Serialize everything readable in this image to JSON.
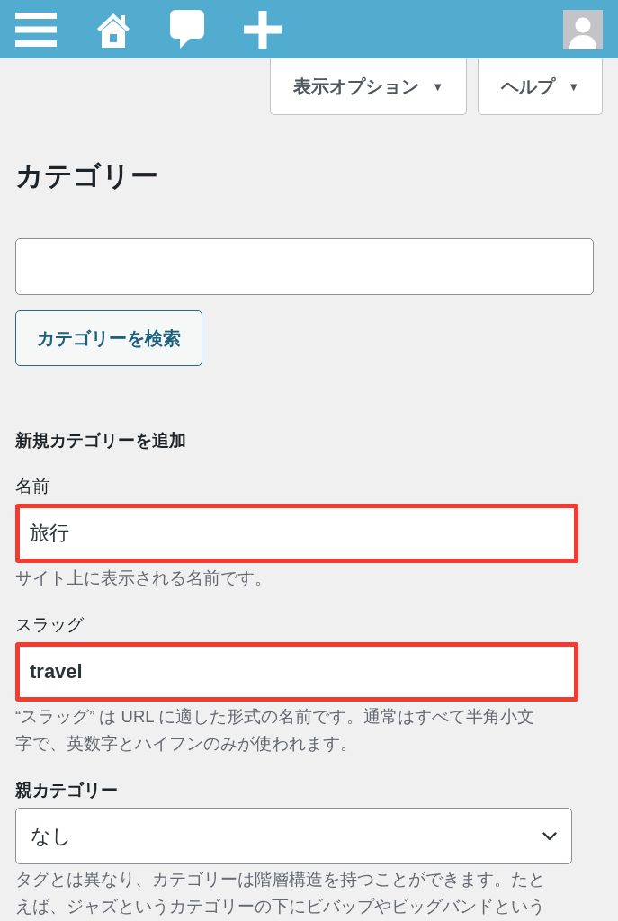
{
  "top_tabs": [
    {
      "label": "表示オプション",
      "caret": "▼"
    },
    {
      "label": "ヘルプ",
      "caret": "▼"
    }
  ],
  "page_title": "カテゴリー",
  "search": {
    "button": "カテゴリーを検索"
  },
  "add_form": {
    "heading": "新規カテゴリーを追加",
    "fields": [
      {
        "kind": "text",
        "label": "名前",
        "value": "旅行",
        "highlighted": true,
        "help": "サイト上に表示される名前です。"
      },
      {
        "kind": "text",
        "label": "スラッグ",
        "value": "travel",
        "highlighted": true,
        "help": "“スラッグ” は URL に適した形式の名前です。通常はすべて半角小文字で、英数字とハイフンのみが使われます。"
      },
      {
        "kind": "select",
        "label": "親カテゴリー",
        "value": "なし",
        "highlighted": false,
        "help": "タグとは異なり、カテゴリーは階層構造を持つことができます。たとえば、ジャズというカテゴリーの下にビバップやビッグバンドという"
      }
    ]
  }
}
